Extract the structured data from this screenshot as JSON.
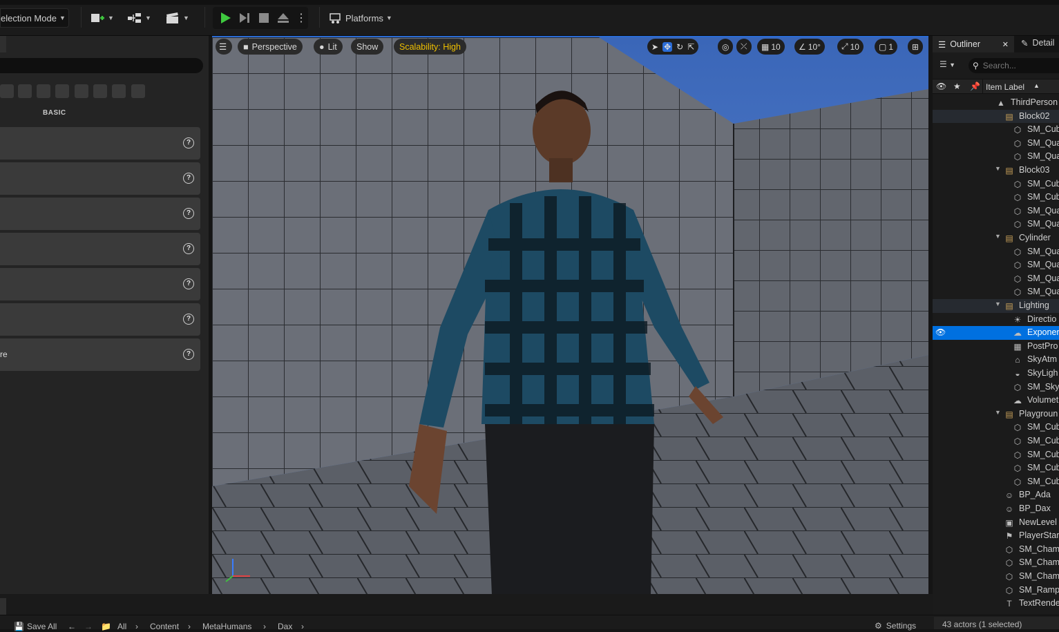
{
  "toolbar": {
    "mode_label": "election Mode",
    "platforms_label": "Platforms"
  },
  "left_panel": {
    "section_label": "BASIC",
    "rows": [
      "",
      "",
      "",
      "",
      "",
      "",
      "re"
    ],
    "help_glyph": "?"
  },
  "viewport": {
    "menu_icon": "hamburger-icon",
    "perspective_label": "Perspective",
    "lit_label": "Lit",
    "show_label": "Show",
    "scalability_label": "Scalability: High",
    "grid_snap": "10",
    "rotation_snap": "10°",
    "scale_snap": "10",
    "camera_speed": "1",
    "accent": "#2b6cd6",
    "scalability_color": "#f0c000"
  },
  "outliner": {
    "tab_label": "Outliner",
    "details_tab_label": "Detail",
    "search_placeholder": "Search...",
    "column_label": "Item Label",
    "items": [
      {
        "label": "ThirdPerson",
        "depth": 0,
        "icon": "level-icon"
      },
      {
        "label": "Block02",
        "depth": 1,
        "icon": "folder-icon"
      },
      {
        "label": "SM_Cub",
        "depth": 2,
        "icon": "mesh-icon"
      },
      {
        "label": "SM_Qua",
        "depth": 2,
        "icon": "mesh-icon"
      },
      {
        "label": "SM_Qua",
        "depth": 2,
        "icon": "mesh-icon"
      },
      {
        "label": "Block03",
        "depth": 1,
        "icon": "folder-icon"
      },
      {
        "label": "SM_Cub",
        "depth": 2,
        "icon": "mesh-icon"
      },
      {
        "label": "SM_Cub",
        "depth": 2,
        "icon": "mesh-icon"
      },
      {
        "label": "SM_Qua",
        "depth": 2,
        "icon": "mesh-icon"
      },
      {
        "label": "SM_Qua",
        "depth": 2,
        "icon": "mesh-icon"
      },
      {
        "label": "Cylinder",
        "depth": 1,
        "icon": "folder-icon"
      },
      {
        "label": "SM_Qua",
        "depth": 2,
        "icon": "mesh-icon"
      },
      {
        "label": "SM_Qua",
        "depth": 2,
        "icon": "mesh-icon"
      },
      {
        "label": "SM_Qua",
        "depth": 2,
        "icon": "mesh-icon"
      },
      {
        "label": "SM_Qua",
        "depth": 2,
        "icon": "mesh-icon"
      },
      {
        "label": "Lighting",
        "depth": 1,
        "icon": "folder-icon"
      },
      {
        "label": "Directio",
        "depth": 2,
        "icon": "sun-icon"
      },
      {
        "label": "Exponer",
        "depth": 2,
        "icon": "fog-icon"
      },
      {
        "label": "PostPro",
        "depth": 2,
        "icon": "postprocess-icon"
      },
      {
        "label": "SkyAtm",
        "depth": 2,
        "icon": "sky-atmosphere-icon"
      },
      {
        "label": "SkyLigh",
        "depth": 2,
        "icon": "skylight-icon"
      },
      {
        "label": "SM_Sky",
        "depth": 2,
        "icon": "mesh-icon"
      },
      {
        "label": "Volumet",
        "depth": 2,
        "icon": "cloud-icon"
      },
      {
        "label": "Playgroun",
        "depth": 1,
        "icon": "folder-icon"
      },
      {
        "label": "SM_Cub",
        "depth": 2,
        "icon": "mesh-icon"
      },
      {
        "label": "SM_Cub",
        "depth": 2,
        "icon": "mesh-icon"
      },
      {
        "label": "SM_Cub",
        "depth": 2,
        "icon": "mesh-icon"
      },
      {
        "label": "SM_Cub",
        "depth": 2,
        "icon": "mesh-icon"
      },
      {
        "label": "SM_Cub",
        "depth": 2,
        "icon": "mesh-icon"
      },
      {
        "label": "BP_Ada",
        "depth": 1,
        "icon": "pawn-icon"
      },
      {
        "label": "BP_Dax",
        "depth": 1,
        "icon": "pawn-icon"
      },
      {
        "label": "NewLevel",
        "depth": 1,
        "icon": "sequence-icon"
      },
      {
        "label": "PlayerStar",
        "depth": 1,
        "icon": "player-start-icon"
      },
      {
        "label": "SM_Cham",
        "depth": 1,
        "icon": "mesh-icon"
      },
      {
        "label": "SM_Cham",
        "depth": 1,
        "icon": "mesh-icon"
      },
      {
        "label": "SM_Cham",
        "depth": 1,
        "icon": "mesh-icon"
      },
      {
        "label": "SM_Ramp",
        "depth": 1,
        "icon": "mesh-icon"
      },
      {
        "label": "TextRende",
        "depth": 1,
        "icon": "text-icon"
      }
    ],
    "status": "43 actors (1 selected)"
  },
  "bottom": {
    "save_all_label": "Save All",
    "breadcrumb": [
      "All",
      "Content",
      "MetaHumans",
      "Dax"
    ],
    "settings_label": "Settings"
  }
}
